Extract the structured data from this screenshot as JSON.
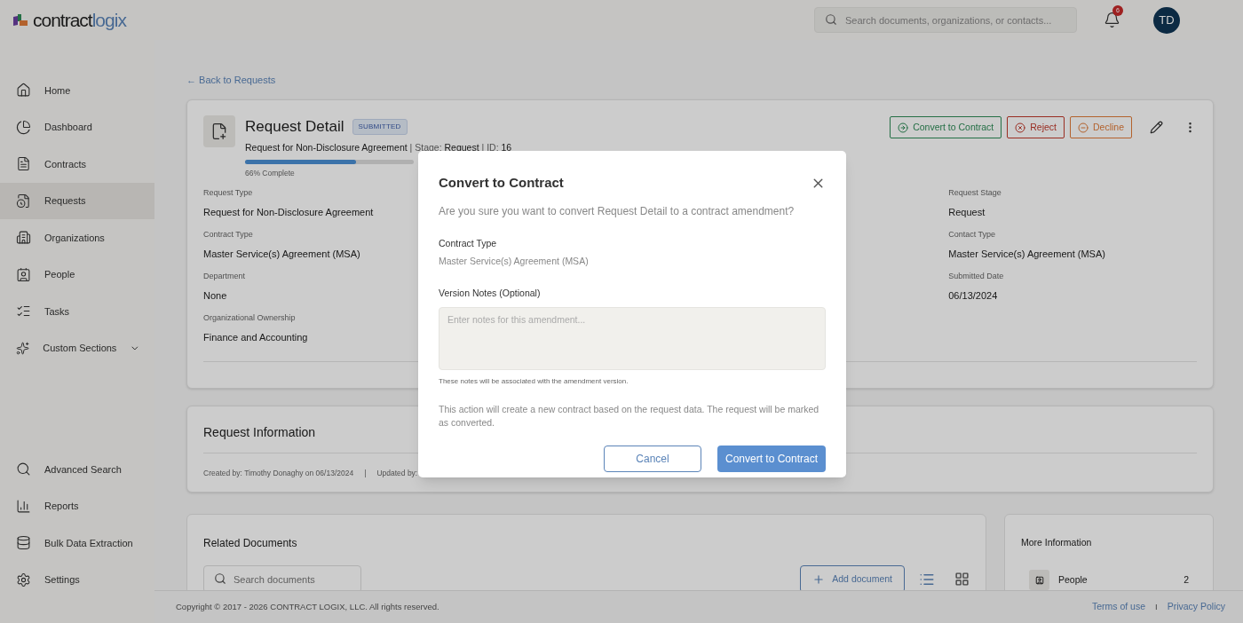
{
  "header": {
    "logo": {
      "part_1": "contract",
      "part_2": "logix"
    },
    "search": {
      "placeholder": "Search documents, organizations, or contacts..."
    },
    "notifications": {
      "count": "6"
    },
    "avatar": {
      "initials": "TD"
    }
  },
  "sidebar": {
    "top_items": [
      {
        "label": "Home",
        "selected": false
      },
      {
        "label": "Dashboard",
        "selected": false
      },
      {
        "label": "Contracts",
        "selected": false
      },
      {
        "label": "Requests",
        "selected": true
      },
      {
        "label": "Organizations",
        "selected": false
      },
      {
        "label": "People",
        "selected": false
      },
      {
        "label": "Tasks",
        "selected": false
      },
      {
        "label": "Custom Sections",
        "selected": false,
        "expanded": false
      }
    ],
    "bottom_items": [
      {
        "label": "Advanced Search",
        "selected": false
      },
      {
        "label": "Reports",
        "selected": false
      },
      {
        "label": "Bulk Data Extraction",
        "selected": false
      },
      {
        "label": "Settings",
        "selected": false
      }
    ]
  },
  "back_link": "← Back to Requests",
  "request": {
    "title": "Request Detail",
    "status": "SUBMITTED",
    "subtitle": "**Request for Non-Disclosure Agreement** | Stage: **Request** | ID: **16**",
    "progress": {
      "level": 0.66,
      "label": "66% Complete"
    },
    "actions": [
      {
        "label": "Convert to Contract",
        "kind": "convert"
      },
      {
        "label": "Reject",
        "kind": "reject"
      },
      {
        "label": "Decline",
        "kind": "decline"
      }
    ],
    "fields_left": [
      {
        "label": "Request Type",
        "value": "Request for Non-Disclosure Agreement"
      },
      {
        "label": "Contract Type",
        "value": "Master Service(s) Agreement (MSA)"
      },
      {
        "label": "Department",
        "value": "None"
      },
      {
        "label": "Organizational Ownership",
        "value": "Finance and Accounting"
      }
    ],
    "fields_right": [
      {
        "label": "Request Stage",
        "value": "Request"
      },
      {
        "label": "Contact Type",
        "value": "Master Service(s) Agreement (MSA)"
      },
      {
        "label": "Submitted Date",
        "value": "06/13/2024"
      }
    ]
  },
  "request_information": {
    "title": "Request Information",
    "created": "Created by: Timothy Donaghy on 06/13/2024",
    "separator": "|",
    "updated": "Updated by:"
  },
  "related_documents": {
    "title": "Related Documents",
    "search": {
      "placeholder": "Search documents"
    },
    "add_button": "Add document"
  },
  "more_information": {
    "title": "More Information",
    "rows": [
      {
        "label": "People",
        "count": "2"
      }
    ]
  },
  "footer": {
    "copyright": "Copyright © 2017 - 2026 CONTRACT LOGIX, LLC. All rights reserved.",
    "links": [
      "Terms of use",
      "Privacy Policy"
    ],
    "separator": "I"
  },
  "dialog": {
    "title": "Convert to Contract",
    "question": "Are you sure you want to convert Request Detail to a contract amendment?",
    "contract_type": {
      "label": "Contract Type",
      "value": "Master Service(s) Agreement (MSA)"
    },
    "notes": {
      "label": "Version Notes (Optional)",
      "placeholder": "Enter notes for this amendment...",
      "hint": "These notes will be associated with the amendment version."
    },
    "note": "This action will create a new contract based on the request data. The request will be marked as converted.",
    "buttons": [
      {
        "label": "Cancel",
        "kind": "secondary"
      },
      {
        "label": "Convert to Contract",
        "kind": "primary"
      }
    ]
  }
}
